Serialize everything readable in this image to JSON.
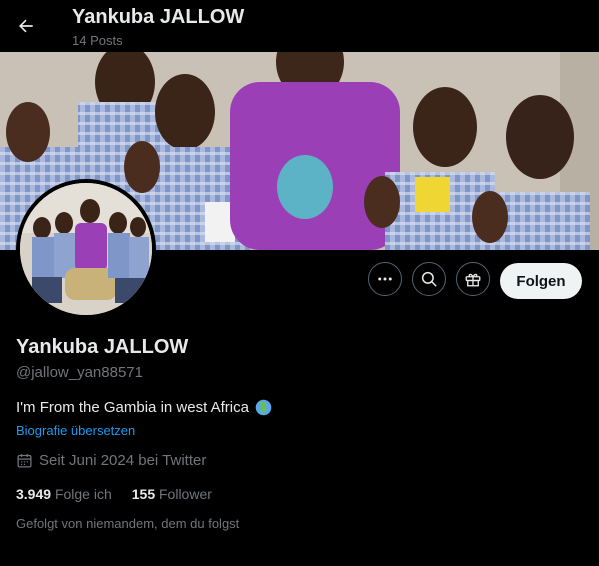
{
  "header": {
    "title": "Yankuba JALLOW",
    "posts_count": "14 Posts"
  },
  "profile": {
    "display_name": "Yankuba JALLOW",
    "handle": "@jallow_yan88571",
    "bio": "I'm From the Gambia in west Africa",
    "bio_emoji": "globe-africa",
    "translate_link": "Biografie übersetzen",
    "joined": "Seit Juni 2024 bei Twitter"
  },
  "stats": {
    "following_count": "3.949",
    "following_label": "Folge ich",
    "followers_count": "155",
    "followers_label": "Follower"
  },
  "followed_by": "Gefolgt von niemandem, dem du folgst",
  "actions": {
    "follow_label": "Folgen",
    "more_icon": "more-horizontal-icon",
    "search_icon": "search-icon",
    "gift_icon": "gift-icon"
  },
  "colors": {
    "background": "#000000",
    "text_primary": "#e7e9ea",
    "text_secondary": "#71767b",
    "link": "#1d9bf0",
    "follow_bg": "#eff3f4"
  }
}
